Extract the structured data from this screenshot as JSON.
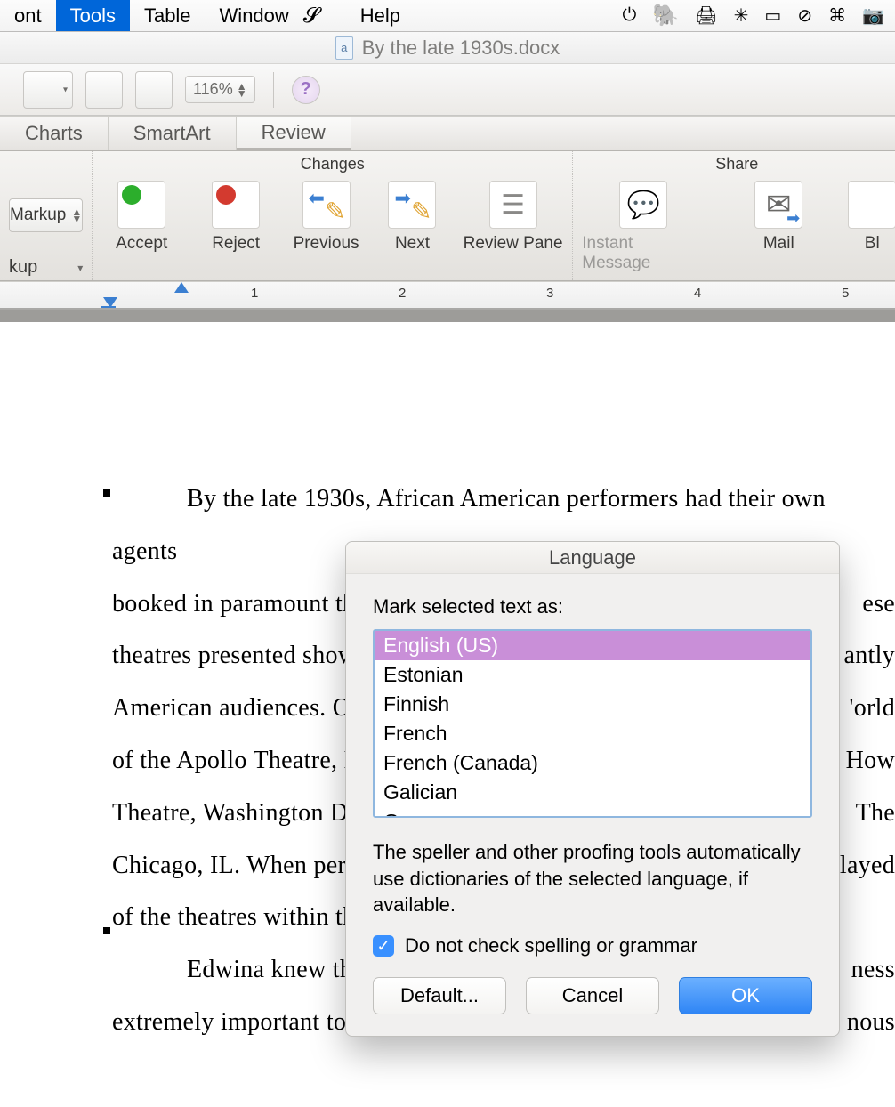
{
  "menubar": {
    "items": [
      "ont",
      "Tools",
      "Table",
      "Window",
      "Help"
    ],
    "active_index": 1,
    "status_icons": [
      "power-icon",
      "arrow-icon",
      "evernote-icon",
      "printer-icon",
      "brightness-icon",
      "display-icon",
      "block-icon",
      "command-icon",
      "camera-icon"
    ]
  },
  "window": {
    "title": "By the late 1930s.docx"
  },
  "toolbar": {
    "zoom": "116%"
  },
  "ribbon": {
    "tabs": [
      "Charts",
      "SmartArt",
      "Review"
    ],
    "active_tab_index": 2,
    "left": {
      "markup": "Markup",
      "kup": "kup"
    },
    "changes": {
      "title": "Changes",
      "buttons": [
        "Accept",
        "Reject",
        "Previous",
        "Next",
        "Review Pane"
      ]
    },
    "share": {
      "title": "Share",
      "buttons": [
        "Instant Message",
        "Mail",
        "Bl"
      ]
    }
  },
  "ruler": {
    "numbers": [
      "1",
      "2",
      "3",
      "4",
      "5"
    ]
  },
  "document": {
    "lines": [
      "By the late 1930s, African American performers had their own agents ",
      "booked in paramount th",
      "theatres presented show",
      "American audiences.  O",
      "of the Apollo Theatre, H",
      "Theatre, Washington DC",
      "Chicago, IL.  When per",
      "of the theatres within the",
      "Edwina knew tha",
      "extremely important to "
    ],
    "right_fragments": [
      "",
      "ese ",
      "antly",
      "'orld",
      " How",
      " The",
      "layed",
      "",
      "ness",
      "nous"
    ]
  },
  "dialog": {
    "title": "Language",
    "label": "Mark selected text as:",
    "languages": [
      "English (US)",
      "Estonian",
      "Finnish",
      "French",
      "French (Canada)",
      "Galician",
      "German"
    ],
    "selected_index": 0,
    "info": "The speller and other proofing tools automatically use dictionaries of the selected language, if available.",
    "checkbox": "Do not check spelling or grammar",
    "checkbox_checked": true,
    "buttons": {
      "default": "Default...",
      "cancel": "Cancel",
      "ok": "OK"
    }
  }
}
